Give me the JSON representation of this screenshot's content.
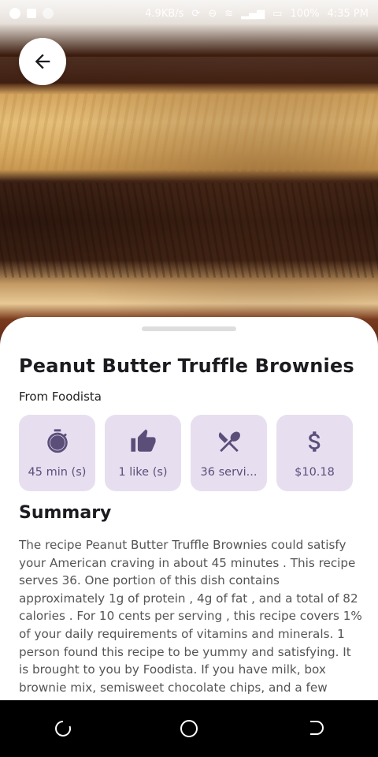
{
  "status_bar": {
    "speed": "4.9KB/s",
    "battery": "100%",
    "time": "4:35 PM"
  },
  "recipe": {
    "title": "Peanut Butter Truffle Brownies",
    "source": "From Foodista"
  },
  "chips": [
    {
      "icon": "timer-icon",
      "label": "45 min (s)"
    },
    {
      "icon": "thumbs-up-icon",
      "label": "1 like (s)"
    },
    {
      "icon": "utensils-icon",
      "label": "36 servi..."
    },
    {
      "icon": "dollar-icon",
      "label": "$10.18"
    }
  ],
  "summary": {
    "heading": "Summary",
    "text": "The recipe Peanut Butter Truffle Brownies could satisfy your American craving in about  45 minutes . This recipe serves 36. One portion of this dish contains approximately  1g of protein ,  4g of fat , and a total of 82 calories . For  10 cents per serving , this recipe  covers 1%  of your daily requirements of vitamins and minerals. 1 person found this recipe to be yummy and satisfying. It is brought to you by Foodista. If you have milk, box brownie mix, semisweet chocolate chips, and a few"
  },
  "colors": {
    "chip_bg": "#e7dff0",
    "chip_accent": "#5b4f7a"
  }
}
